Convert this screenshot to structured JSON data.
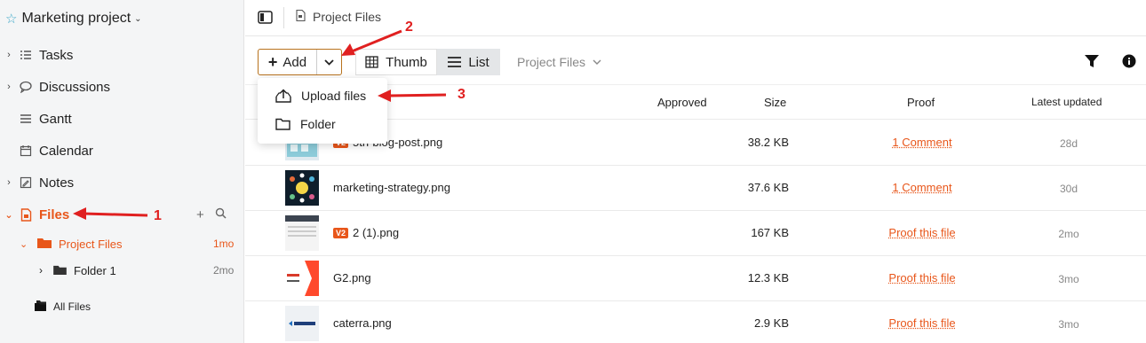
{
  "sidebar": {
    "project_name": "Marketing project",
    "items": [
      {
        "label": "Tasks"
      },
      {
        "label": "Discussions"
      },
      {
        "label": "Gantt"
      },
      {
        "label": "Calendar"
      },
      {
        "label": "Notes"
      },
      {
        "label": "Files"
      }
    ],
    "tree": {
      "project_files": {
        "label": "Project Files",
        "time": "1mo"
      },
      "folder1": {
        "label": "Folder 1",
        "time": "2mo"
      },
      "all_files": {
        "label": "All Files"
      }
    }
  },
  "topbar": {
    "breadcrumb": "Project Files"
  },
  "toolbar": {
    "add_label": "Add",
    "thumb_label": "Thumb",
    "list_label": "List",
    "folder_select": "Project Files"
  },
  "menu": {
    "upload_label": "Upload files",
    "folder_label": "Folder"
  },
  "table": {
    "headers": {
      "approved": "Approved",
      "size": "Size",
      "proof": "Proof",
      "updated": "Latest updated"
    },
    "rows": [
      {
        "badge": "V2",
        "name": "5th-blog-post.png",
        "size": "38.2 KB",
        "proof": "1 Comment",
        "updated": "28d"
      },
      {
        "badge": "",
        "name": "marketing-strategy.png",
        "size": "37.6 KB",
        "proof": "1 Comment",
        "updated": "30d"
      },
      {
        "badge": "V2",
        "name": "2 (1).png",
        "size": "167 KB",
        "proof": "Proof this file",
        "updated": "2mo"
      },
      {
        "badge": "",
        "name": "G2.png",
        "size": "12.3 KB",
        "proof": "Proof this file",
        "updated": "3mo"
      },
      {
        "badge": "",
        "name": "caterra.png",
        "size": "2.9 KB",
        "proof": "Proof this file",
        "updated": "3mo"
      }
    ]
  },
  "annotations": {
    "n1": "1",
    "n2": "2",
    "n3": "3"
  },
  "colors": {
    "accent": "#e8561a",
    "annotation": "#e02020",
    "star": "#3aa7c8"
  }
}
